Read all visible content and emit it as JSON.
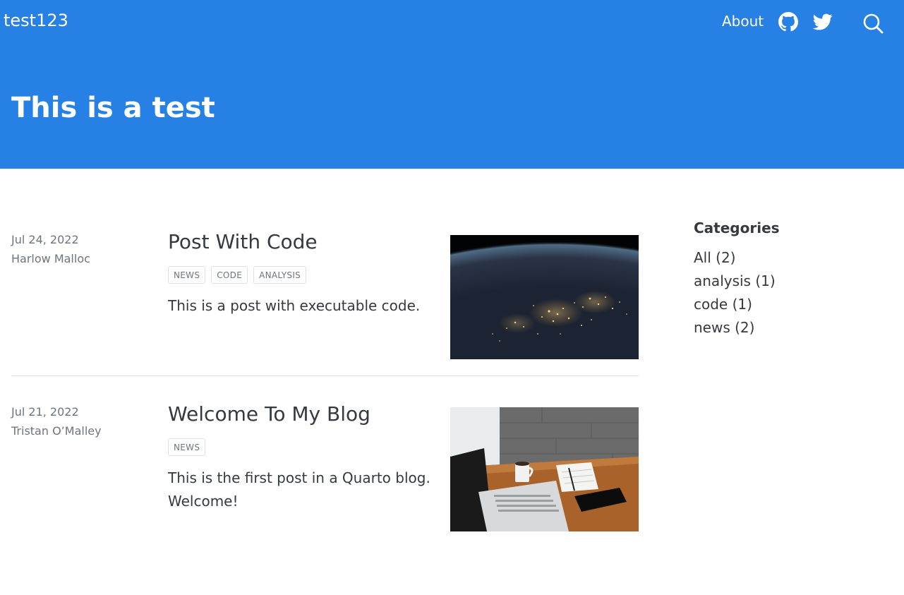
{
  "navbar": {
    "brand": "test123",
    "links": [
      {
        "label": "About"
      }
    ],
    "icons": [
      "github-icon",
      "twitter-icon",
      "search-icon"
    ],
    "color": "#2780e3"
  },
  "header": {
    "title": "This is a test"
  },
  "posts": [
    {
      "date": "Jul 24, 2022",
      "author": "Harlow Malloc",
      "title": "Post With Code",
      "categories": [
        "news",
        "code",
        "analysis"
      ],
      "description": "This is a post with executable code.",
      "thumbnail": "earth-at-night-image"
    },
    {
      "date": "Jul 21, 2022",
      "author": "Tristan O’Malley",
      "title": "Welcome To My Blog",
      "categories": [
        "news"
      ],
      "description": "This is the first post in a Quarto blog. Welcome!",
      "thumbnail": "laptop-desk-image"
    }
  ],
  "sidebar": {
    "title": "Categories",
    "items": [
      {
        "label": "All (2)"
      },
      {
        "label": "analysis (1)"
      },
      {
        "label": "code (1)"
      },
      {
        "label": "news (2)"
      }
    ]
  }
}
